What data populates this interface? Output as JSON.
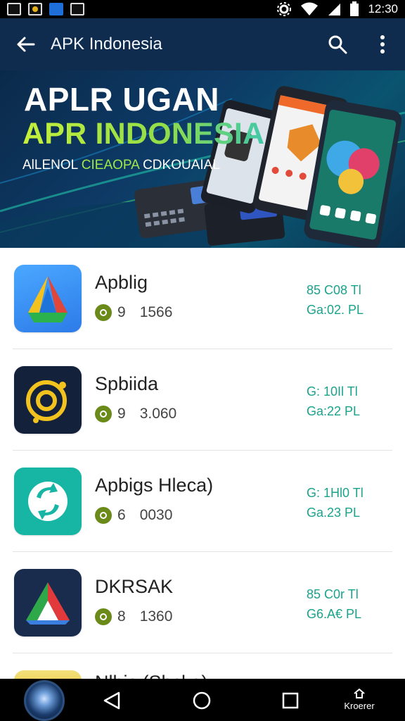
{
  "status_bar": {
    "time": "12:30"
  },
  "app_bar": {
    "title": "APK Indonesia"
  },
  "banner": {
    "headline": "APLR UGAN",
    "headline2": "APR INDONESIA",
    "sub_a": "AlLENOL ",
    "sub_b": "CIEAOPA",
    "sub_c": " CDKOUAIAL"
  },
  "apps": [
    {
      "name": "Apblig",
      "rating": "9",
      "count": "1566",
      "right1": "85 C08 Tl",
      "right2": "Ga:02. PL",
      "icon": "drive-triangle-icon"
    },
    {
      "name": "Spbiida",
      "rating": "9",
      "count": "3.060",
      "right1": "G: 10Il Tl",
      "right2": "Ga:22 PL",
      "icon": "ring-target-icon"
    },
    {
      "name": "Apbigs Hleca)",
      "rating": "6",
      "count": "0030",
      "right1": "G: 1Hl0 Tl",
      "right2": "Ga.23 PL",
      "icon": "sync-bubble-icon"
    },
    {
      "name": "DKRSAK",
      "rating": "8",
      "count": "1360",
      "right1": "85 C0r Tl",
      "right2": "G6.A€ PL",
      "icon": "triangle-logo-icon"
    },
    {
      "name": "Nlbic (Shcka)",
      "icon": "partial-app-icon"
    }
  ],
  "nav": {
    "right_label": "Kroerer"
  }
}
